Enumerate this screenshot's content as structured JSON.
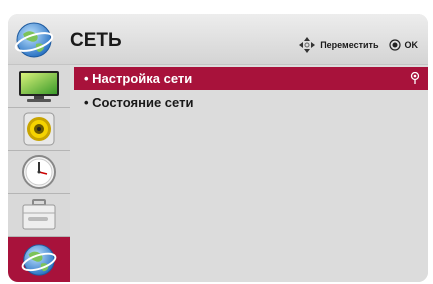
{
  "header": {
    "title": "СЕТЬ",
    "move_hint": "Переместить",
    "ok_hint": "OK"
  },
  "sidebar": {
    "items": [
      {
        "icon": "tv-screen-icon"
      },
      {
        "icon": "speaker-icon"
      },
      {
        "icon": "clock-icon"
      },
      {
        "icon": "toolbox-icon"
      },
      {
        "icon": "globe-network-icon",
        "selected": true
      }
    ]
  },
  "menu": {
    "items": [
      {
        "label": "• Настройка сети",
        "selected": true
      },
      {
        "label": "• Состояние сети",
        "selected": false
      }
    ]
  },
  "colors": {
    "accent": "#a8123b",
    "panel": "#dcdcdc"
  }
}
